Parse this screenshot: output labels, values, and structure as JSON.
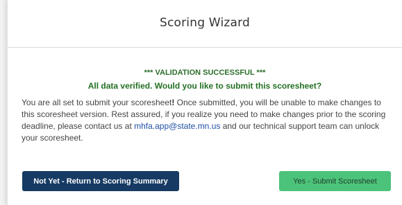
{
  "modal": {
    "title": "Scoring Wizard"
  },
  "validation": {
    "status": "*** VALIDATION SUCCESSFUL ***",
    "question": "All data verified. Would you like to submit this scoresheet?"
  },
  "message": {
    "part1": "You are all set to submit your scoresheet",
    "exclaim": "!",
    "part2": " Once submitted, you will be unable to make changes to this scoresheet version. Rest assured, if you realize you need to make changes prior to the scoring deadline, please contact us at ",
    "email": "mhfa.app@state.mn.us",
    "part3": " and our technical support team can unlock your scoresheet."
  },
  "buttons": {
    "back_label": "Not Yet - Return to Scoring Summary",
    "submit_label": "Yes - Submit Scoresheet"
  },
  "colors": {
    "success_text": "#2b6e2b",
    "primary_button": "#163a63",
    "submit_button": "#4cc37a",
    "link": "#1f4fa8"
  }
}
